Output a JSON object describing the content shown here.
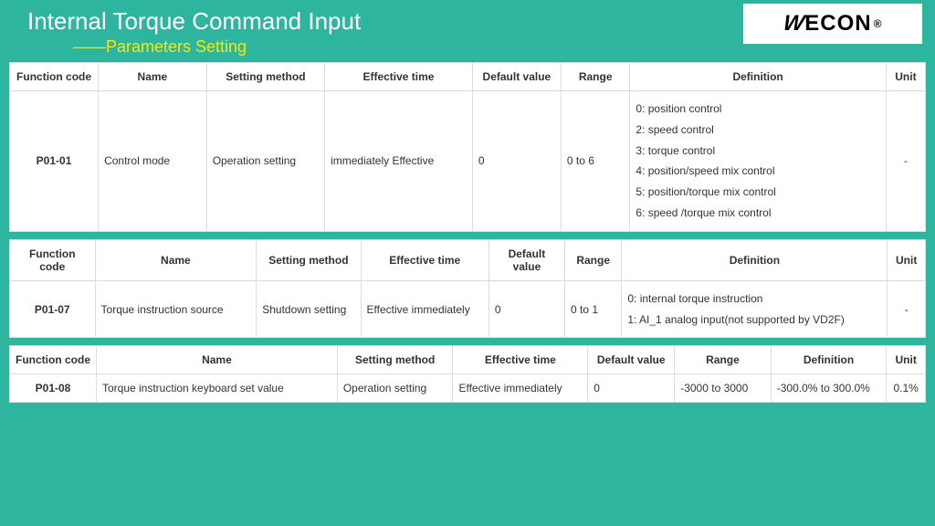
{
  "header": {
    "title": "Internal Torque Command Input",
    "subtitle": "——Parameters Setting"
  },
  "logo": {
    "text": "WECON",
    "reg": "®"
  },
  "columns": {
    "fc": "Function code",
    "name": "Name",
    "sm": "Setting method",
    "et": "Effective time",
    "dv": "Default value",
    "rg": "Range",
    "def": "Definition",
    "unit": "Unit"
  },
  "t1": {
    "fc": "P01-01",
    "name": "Control mode",
    "sm": "Operation setting",
    "et": "immediately Effective",
    "dv": "0",
    "rg": "0 to 6",
    "def0": "0: position control",
    "def2": "2: speed control",
    "def3": "3: torque control",
    "def4": "4: position/speed mix control",
    "def5": "5: position/torque mix control",
    "def6": "6: speed /torque mix control",
    "unit": "-"
  },
  "t2": {
    "fc": "P01-07",
    "name": "Torque instruction source",
    "sm": "Shutdown setting",
    "et": "Effective immediately",
    "dv": "0",
    "rg": "0 to 1",
    "def0": "0: internal torque instruction",
    "def1": "1: AI_1 analog input(not supported by VD2F)",
    "unit": "-"
  },
  "t3": {
    "fc": "P01-08",
    "name": "Torque instruction keyboard set value",
    "sm": "Operation setting",
    "et": "Effective immediately",
    "dv": "0",
    "rg": "-3000 to 3000",
    "def": "-300.0% to 300.0%",
    "unit": "0.1%"
  }
}
